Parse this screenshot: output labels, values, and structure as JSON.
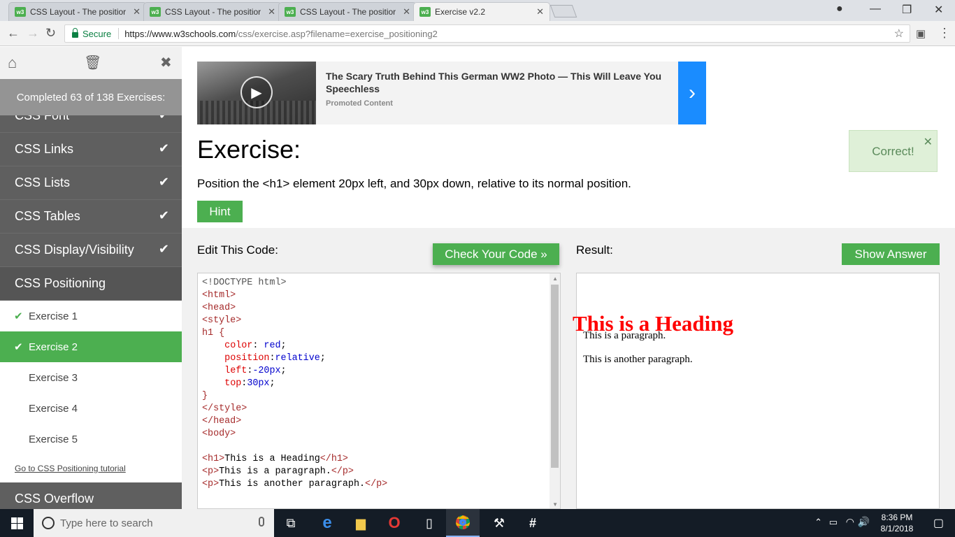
{
  "browser": {
    "tabs": [
      {
        "title": "CSS Layout - The positior",
        "active": false
      },
      {
        "title": "CSS Layout - The positior",
        "active": false
      },
      {
        "title": "CSS Layout - The positior",
        "active": false
      },
      {
        "title": "Exercise v2.2",
        "active": true
      }
    ],
    "favicon_text": "w3",
    "secure_label": "Secure",
    "url_main": "https://www.w3schools.com",
    "url_rest": "/css/exercise.asp?filename=exercise_positioning2"
  },
  "sidebar": {
    "progress": "Completed 63 of 138 Exercises:",
    "items_before": [
      {
        "label": "CSS Font"
      },
      {
        "label": "CSS Links"
      },
      {
        "label": "CSS Lists"
      },
      {
        "label": "CSS Tables"
      },
      {
        "label": "CSS Display/Visibility"
      }
    ],
    "current_section": "CSS Positioning",
    "exercises": [
      {
        "label": "Exercise 1",
        "completed": true
      },
      {
        "label": "Exercise 2",
        "completed": true,
        "active": true
      },
      {
        "label": "Exercise 3"
      },
      {
        "label": "Exercise 4"
      },
      {
        "label": "Exercise 5"
      }
    ],
    "tutorial_link": "Go to CSS Positioning tutorial",
    "next_section": "CSS Overflow"
  },
  "ad": {
    "title": "The Scary Truth Behind This German WW2 Photo — This Will Leave You Speechless",
    "promoted": "Promoted Content"
  },
  "exercise": {
    "title": "Exercise:",
    "description": "Position the <h1> element 20px left, and 30px down, relative to its normal position.",
    "hint_label": "Hint",
    "correct_text": "Correct!",
    "edit_label": "Edit This Code:",
    "check_label": "Check Your Code »",
    "result_label": "Result:",
    "answer_label": "Show Answer"
  },
  "code": {
    "doctype": "<!DOCTYPE html>",
    "html_open": "<html>",
    "head_open": "<head>",
    "style_open": "<style>",
    "selector": "h1 {",
    "decl": [
      {
        "prop": "color",
        "value": "red"
      },
      {
        "prop": "position",
        "value": "relative"
      },
      {
        "prop": "left",
        "value": "-20px"
      },
      {
        "prop": "top",
        "value": "30px"
      }
    ],
    "close_brace": "}",
    "style_close": "</style>",
    "head_close": "</head>",
    "body_open": "<body>",
    "h1_text": "This is a Heading",
    "p1_text": "This is a paragraph.",
    "p2_text": "This is another paragraph."
  },
  "result": {
    "heading": "This is a Heading",
    "p1": "This is a paragraph.",
    "p2": "This is another paragraph."
  },
  "taskbar": {
    "search_placeholder": "Type here to search",
    "time": "8:36 PM",
    "date": "8/1/2018"
  },
  "colors": {
    "accent_green": "#4caf50",
    "error_red": "#ff0000",
    "ad_blue": "#1a8cff"
  }
}
